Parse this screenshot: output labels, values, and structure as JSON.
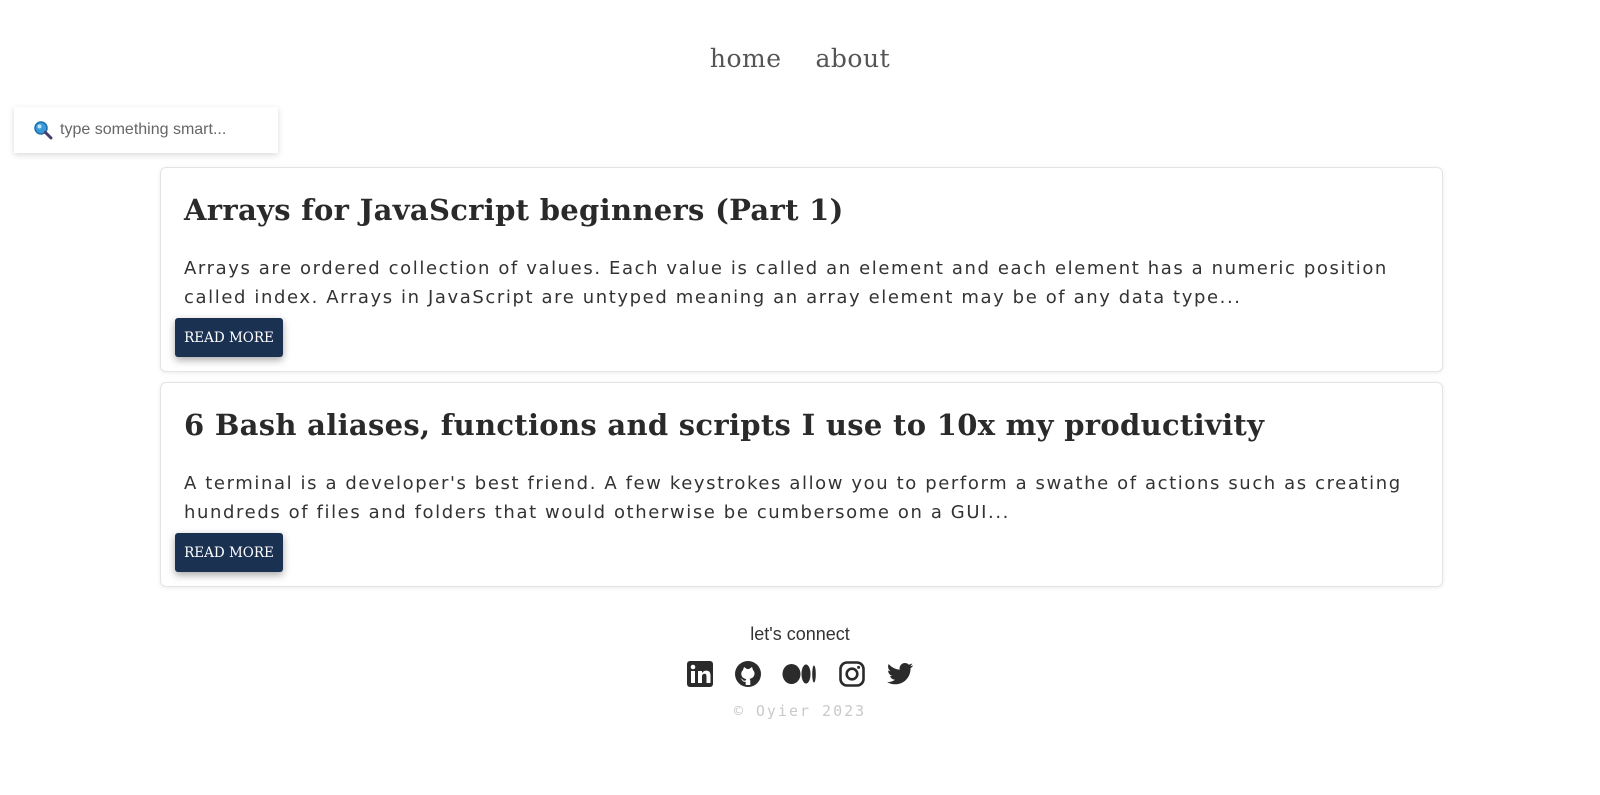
{
  "nav": {
    "items": [
      {
        "label": "home"
      },
      {
        "label": "about"
      }
    ]
  },
  "search": {
    "placeholder": "type something smart...",
    "icon": "magnifier-icon"
  },
  "posts": [
    {
      "title": "Arrays for JavaScript beginners (Part 1)",
      "excerpt": "Arrays are ordered collection of values. Each value is called an element and each element has a numeric position called index. Arrays in JavaScript are untyped meaning an array element may be of any data type...",
      "button_label": "READ MORE"
    },
    {
      "title": "6 Bash aliases, functions and scripts I use to 10x my productivity",
      "excerpt": "A terminal is a developer's best friend. A few keystrokes allow you to perform a swathe of actions such as creating hundreds of files and folders that would otherwise be cumbersome on a GUI...",
      "button_label": "READ MORE"
    }
  ],
  "footer": {
    "connect_label": "let's connect",
    "socials": [
      "linkedin-icon",
      "github-icon",
      "medium-icon",
      "instagram-icon",
      "twitter-icon"
    ],
    "copyright": "© Oyier 2023"
  },
  "colors": {
    "button_bg": "#1b3152",
    "text": "#2b2b2b",
    "copyright": "#c9c9c9"
  }
}
